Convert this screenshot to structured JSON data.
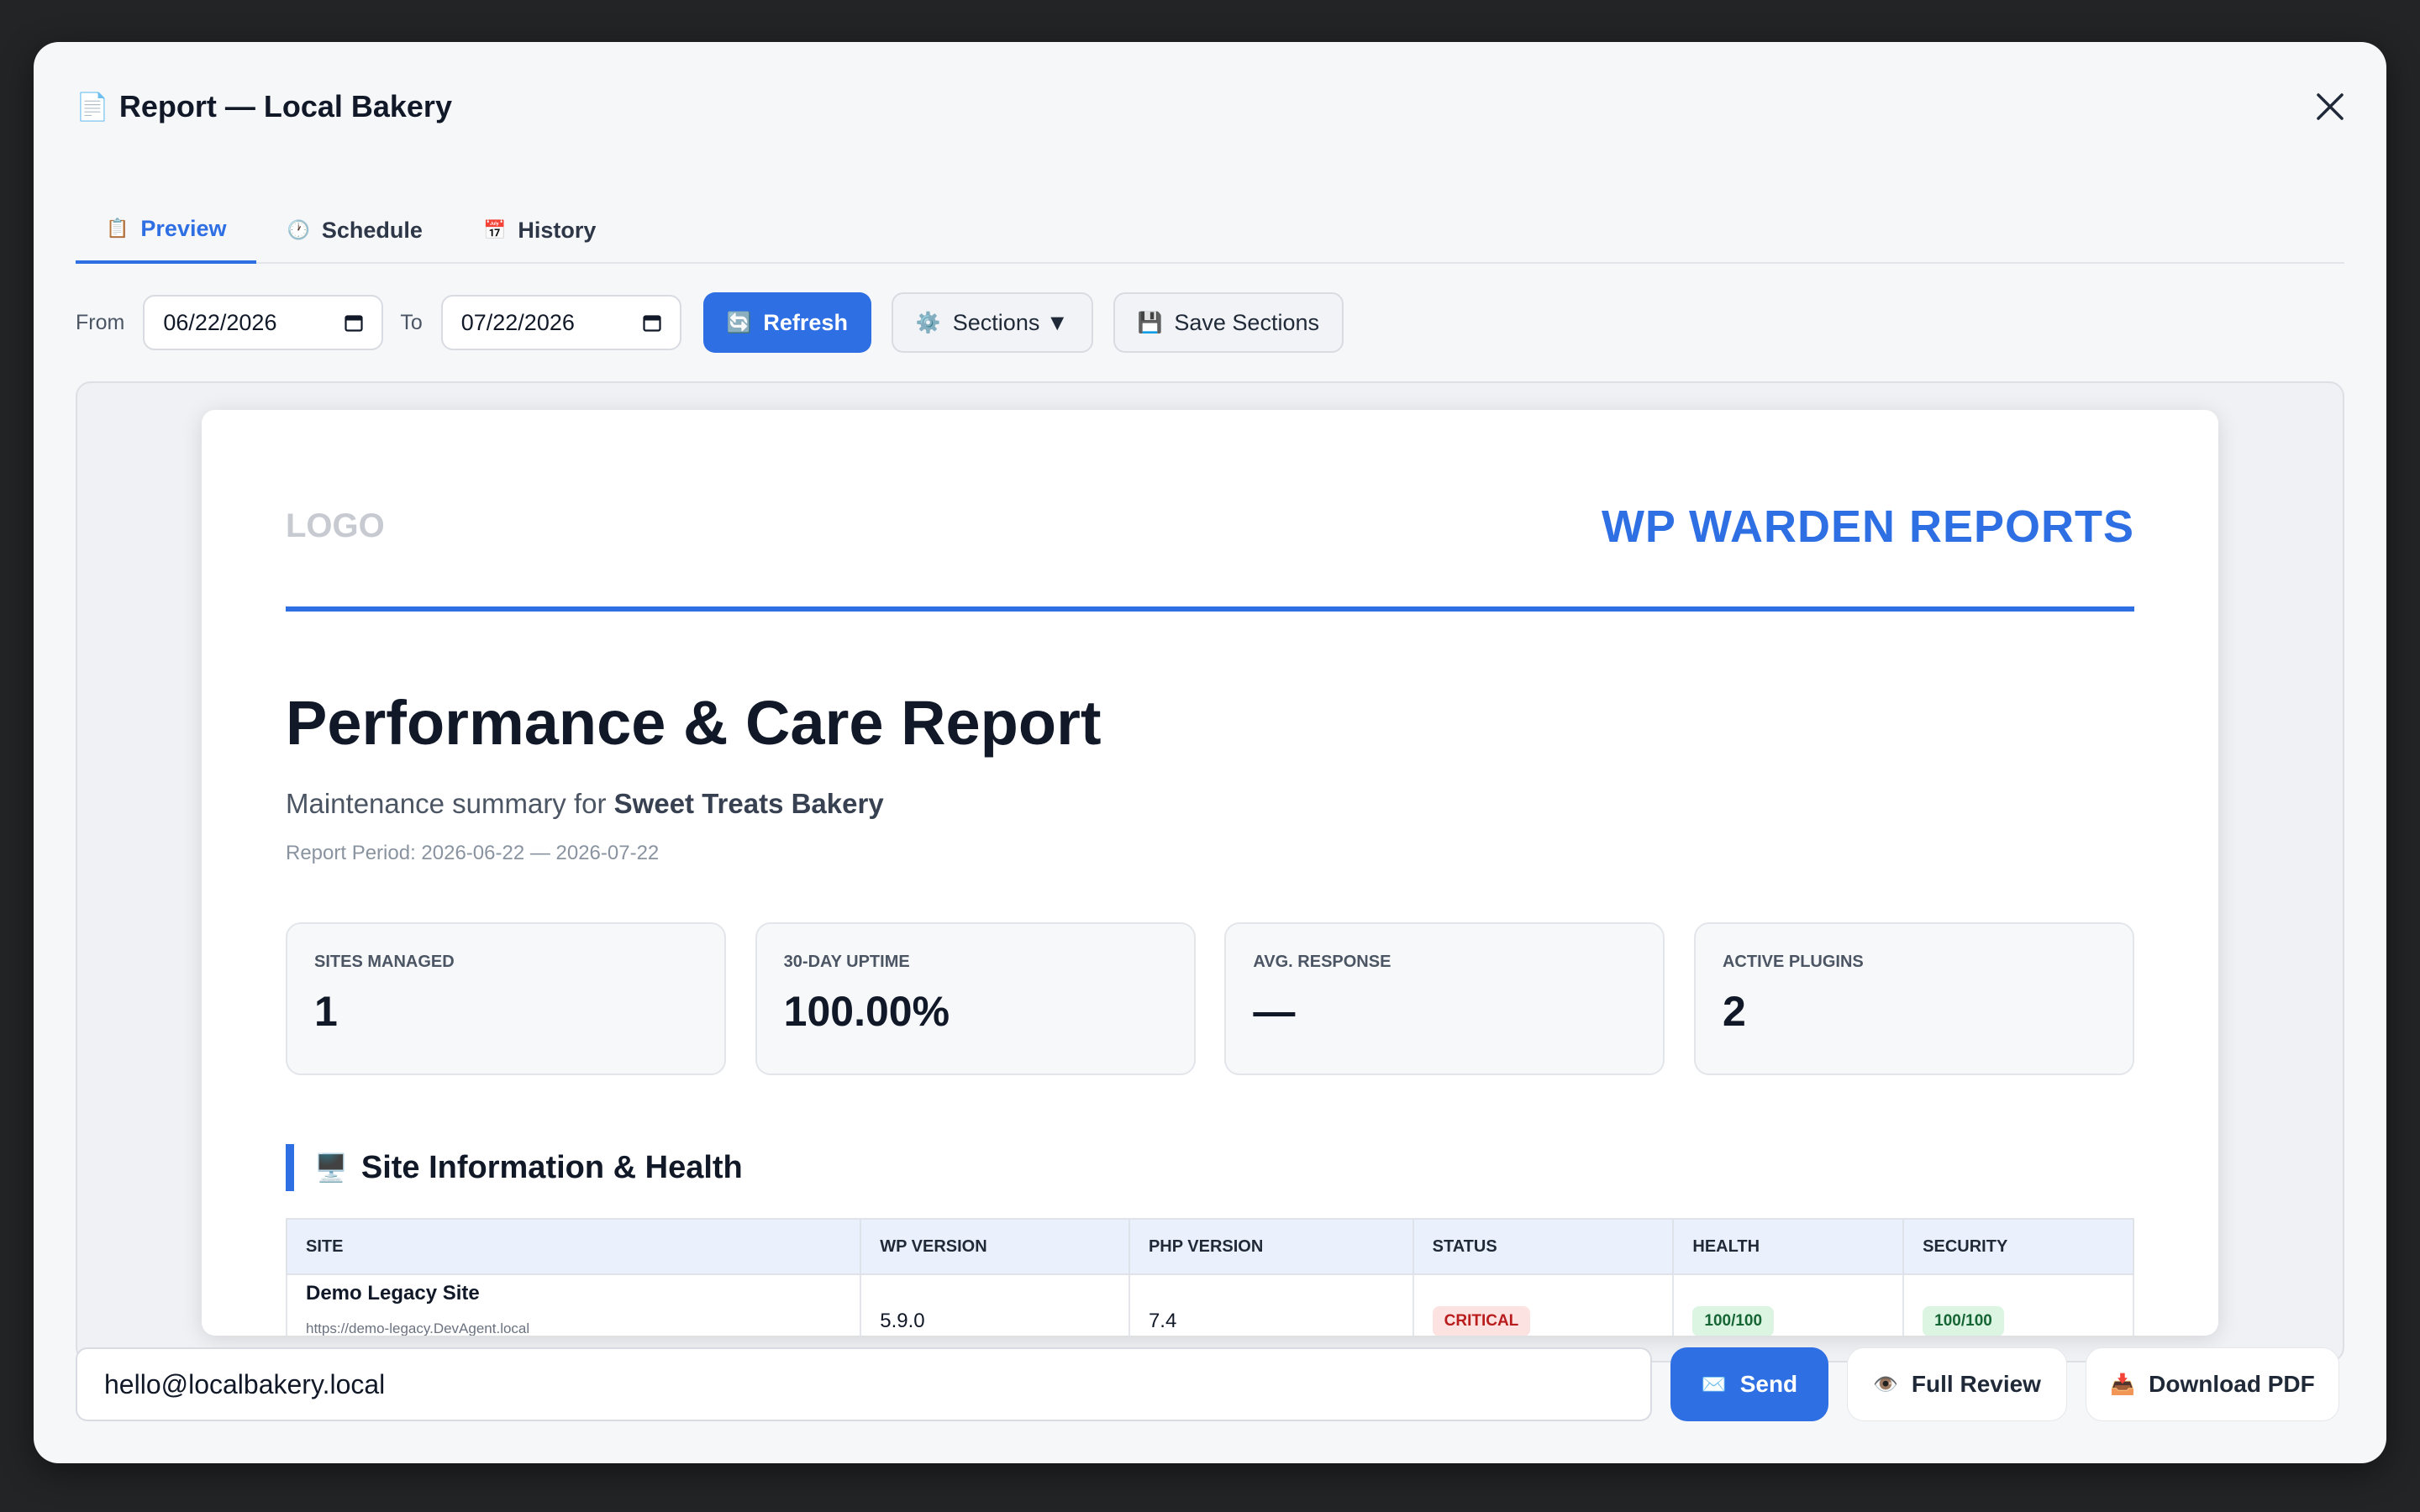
{
  "modal": {
    "title_icon": "page-icon",
    "title": "Report — Local Bakery"
  },
  "tabs": [
    {
      "label": "Preview",
      "icon": "clipboard-icon",
      "active": true
    },
    {
      "label": "Schedule",
      "icon": "clock-icon",
      "active": false
    },
    {
      "label": "History",
      "icon": "calendar-icon",
      "active": false
    }
  ],
  "toolbar": {
    "from_label": "From",
    "from_value": "06/22/2026",
    "to_label": "To",
    "to_value": "07/22/2026",
    "refresh_label": "Refresh",
    "sections_label": "Sections ▼",
    "save_sections_label": "Save Sections"
  },
  "report": {
    "logo": "LOGO",
    "brand": "WP WARDEN REPORTS",
    "title": "Performance & Care Report",
    "subtitle_prefix": "Maintenance summary for",
    "client": "Sweet Treats Bakery",
    "period": "Report Period: 2026-06-22 — 2026-07-22",
    "stats": [
      {
        "label": "SITES MANAGED",
        "value": "1"
      },
      {
        "label": "30-DAY UPTIME",
        "value": "100.00%"
      },
      {
        "label": "AVG. RESPONSE",
        "value": "—"
      },
      {
        "label": "ACTIVE PLUGINS",
        "value": "2"
      }
    ],
    "section_title": "Site Information & Health",
    "table": {
      "headers": [
        "SITE",
        "WP VERSION",
        "PHP VERSION",
        "STATUS",
        "HEALTH",
        "SECURITY"
      ],
      "rows": [
        {
          "site": "Demo Legacy Site",
          "url": "https://demo-legacy.DevAgent.local",
          "wp_version": "5.9.0",
          "php_version": "7.4",
          "status": "CRITICAL",
          "health": "100/100",
          "security": "100/100"
        }
      ]
    }
  },
  "footer": {
    "email_value": "hello@localbakery.local",
    "send_label": "Send",
    "full_review_label": "Full Review",
    "download_label": "Download PDF"
  },
  "colors": {
    "accent": "#2f6fe4",
    "critical": "#b91c1c",
    "good": "#166534"
  }
}
